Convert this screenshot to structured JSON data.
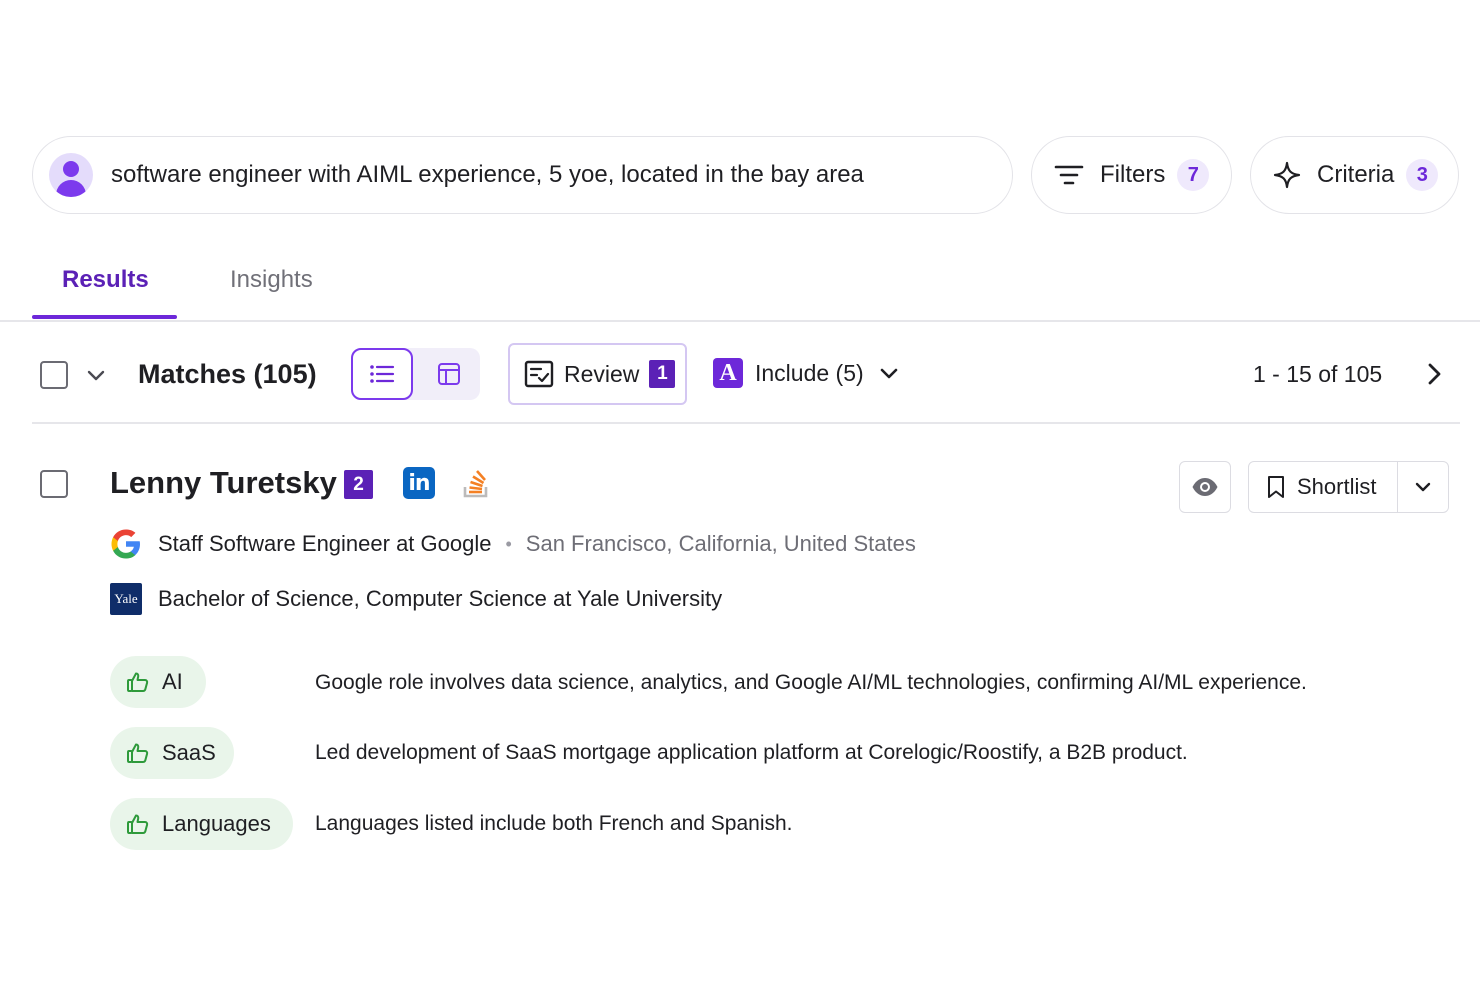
{
  "search": {
    "query": "software engineer with AIML experience, 5 yoe, located in the bay area",
    "filters_label": "Filters",
    "filters_count": "7",
    "criteria_label": "Criteria",
    "criteria_count": "3"
  },
  "tabs": [
    {
      "label": "Results",
      "active": true
    },
    {
      "label": "Insights",
      "active": false
    }
  ],
  "toolbar": {
    "matches_label": "Matches (105)",
    "review_label": "Review",
    "review_count": "1",
    "include_logo": "A",
    "include_label": "Include (5)",
    "pagination": "1 - 15 of 105"
  },
  "candidate": {
    "name": "Lenny Turetsky",
    "badge": "2",
    "linkedin_label": "in",
    "job_title": "Staff Software Engineer at Google",
    "location": "San Francisco, California, United States",
    "education_logo": "Yale",
    "education": "Bachelor of Science, Computer Science at Yale University",
    "shortlist_label": "Shortlist",
    "criteria": [
      {
        "label": "AI",
        "reason": "Google role involves data science, analytics, and Google AI/ML technologies, confirming AI/ML experience."
      },
      {
        "label": "SaaS",
        "reason": "Led development of SaaS mortgage application platform at Corelogic/Roostify, a B2B product."
      },
      {
        "label": "Languages",
        "reason": "Languages listed include both French and Spanish."
      }
    ]
  },
  "colors": {
    "accent": "#6d28d9",
    "accent_dark": "#5b21b6",
    "chip_green": "#e9f5ea",
    "thumb_green": "#2e9a3b",
    "linkedin_blue": "#0a66c2",
    "yale_blue": "#0f2d69"
  },
  "icons": [
    "user-avatar-icon",
    "filter-lines-icon",
    "sparkle-icon",
    "chevron-down-icon",
    "list-view-icon",
    "table-view-icon",
    "review-checklist-icon",
    "include-logo-icon",
    "chevron-right-icon",
    "linkedin-icon",
    "stackoverflow-icon",
    "google-logo-icon",
    "yale-logo-icon",
    "eye-icon",
    "bookmark-icon",
    "thumbs-up-icon"
  ]
}
